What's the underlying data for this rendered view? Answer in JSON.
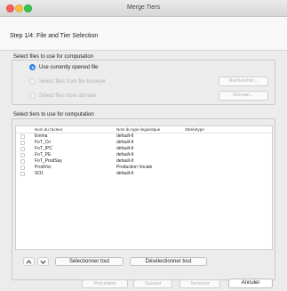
{
  "window": {
    "title": "Merge Tiers"
  },
  "header": {
    "step": "Step 1/4: File and Tier Selection"
  },
  "files_section": {
    "label": "Select files to use for computation",
    "options": [
      {
        "label": "Use currently opened file",
        "selected": true,
        "enabled": true
      },
      {
        "label": "Select files from file browser",
        "selected": false,
        "enabled": false,
        "button": "Rechercher..."
      },
      {
        "label": "Select files from domain",
        "selected": false,
        "enabled": false,
        "button": "Domain..."
      }
    ]
  },
  "tiers_section": {
    "label": "Select tiers to use for computation",
    "columns": [
      "Nom du l'acteur",
      "Nom du type linguistique",
      "Stéréotype"
    ],
    "rows": [
      {
        "name": "Emma",
        "type": "default-lt",
        "stereotype": ""
      },
      {
        "name": "FoT_Cri",
        "type": "default-lt",
        "stereotype": ""
      },
      {
        "name": "FoT_IPC",
        "type": "default-lt",
        "stereotype": ""
      },
      {
        "name": "FoT_PE",
        "type": "default-lt",
        "stereotype": ""
      },
      {
        "name": "FoT_ProdSay",
        "type": "default-lt",
        "stereotype": ""
      },
      {
        "name": "ProdVoc",
        "type": "Production Vocale",
        "stereotype": ""
      },
      {
        "name": "SO1",
        "type": "default-lt",
        "stereotype": ""
      }
    ],
    "select_all": "Sélectionner tout",
    "deselect_all": "Désélectionner tout"
  },
  "footer": {
    "previous": "Précédent",
    "next": "Suivant",
    "finish": "Terminer",
    "cancel": "Annuler"
  },
  "colors": {
    "accent": "#3b8ff6",
    "close": "#fc615d",
    "minimize": "#fdbc40",
    "zoom": "#34c84a"
  }
}
